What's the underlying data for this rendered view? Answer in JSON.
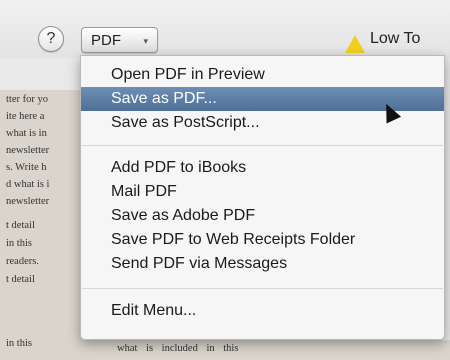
{
  "toolbar": {
    "help_label": "?",
    "pdf_button_label": "PDF",
    "pdf_chevron": "▾",
    "warning_text": "Low To"
  },
  "document": {
    "left_lines": [
      "tter for yo",
      "ite here a",
      "what is in",
      "newsletter",
      "s. Write h",
      "d what is i",
      "newsletter",
      "t  detail",
      "in  this",
      "readers.",
      "t  detail",
      "in  this"
    ],
    "bottom_line": "what is included in this"
  },
  "pdf_menu": {
    "items": [
      {
        "label": "Open PDF in Preview"
      },
      {
        "label": "Save as PDF..."
      },
      {
        "label": "Save as PostScript..."
      },
      {
        "label": "Add PDF to iBooks"
      },
      {
        "label": "Mail PDF"
      },
      {
        "label": "Save as Adobe PDF"
      },
      {
        "label": "Save PDF to Web Receipts Folder"
      },
      {
        "label": "Send PDF via Messages"
      },
      {
        "label": "Edit Menu..."
      }
    ],
    "highlighted_item": "Save as PDF...",
    "highlight_color": "#5a7aa3"
  },
  "colors": {
    "warning": "#f2cf1f"
  }
}
